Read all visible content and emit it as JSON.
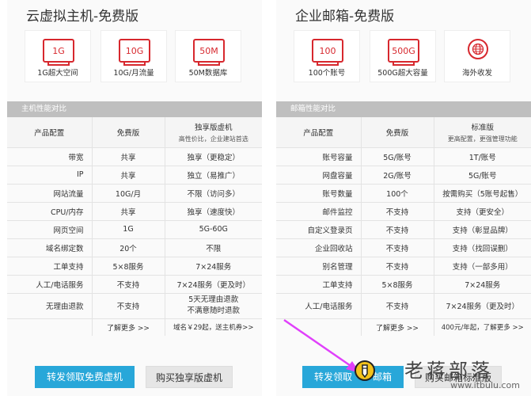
{
  "left": {
    "title": "云虚拟主机-免费版",
    "features": [
      {
        "icon_text": "1G",
        "icon": "storage-icon",
        "caption": "1G超大空间"
      },
      {
        "icon_text": "10G",
        "icon": "traffic-icon",
        "caption": "10G/月流量"
      },
      {
        "icon_text": "50M",
        "icon": "database-icon",
        "caption": "50M数据库"
      }
    ],
    "table_title": "主机性能对比",
    "headers": [
      "产品配置",
      "免费版",
      "独享版虚机"
    ],
    "header_sub": "高性价比，企业建站首选",
    "rows": [
      [
        "带宽",
        "共享",
        "独享（更稳定）"
      ],
      [
        "IP",
        "共享",
        "独立（易推广）"
      ],
      [
        "网站流量",
        "10G/月",
        "不限（访问多）"
      ],
      [
        "CPU/内存",
        "共享",
        "独享（速度快）"
      ],
      [
        "网页空间",
        "1G",
        "5G-60G"
      ],
      [
        "域名绑定数",
        "20个",
        "不限"
      ],
      [
        "工单支持",
        "5×8服务",
        "7×24服务"
      ],
      [
        "人工/电话服务",
        "不支持",
        "7×24服务（更及时）"
      ]
    ],
    "refund": {
      "label": "无理由退款",
      "free": "不支持",
      "line1": "5天无理由退款",
      "line2": "不满意随时退款"
    },
    "footer": {
      "more": "了解更多 >>",
      "promo": "域名￥29起，送主机券>>"
    },
    "btn_primary": "转发领取免费虚机",
    "btn_secondary": "购买独享版虚机"
  },
  "right": {
    "title": "企业邮箱-免费版",
    "features": [
      {
        "icon_text": "100",
        "icon": "accounts-icon",
        "caption": "100个账号"
      },
      {
        "icon_text": "500G",
        "icon": "capacity-icon",
        "caption": "500G超大容量"
      },
      {
        "icon_text": "",
        "icon": "globe-icon",
        "caption": "海外收发"
      }
    ],
    "table_title": "邮箱性能对比",
    "headers": [
      "产品配置",
      "免费版",
      "标准版"
    ],
    "header_sub": "更高配置，更强管理功能",
    "rows": [
      [
        "账号容量",
        "5G/账号",
        "1T/账号"
      ],
      [
        "网盘容量",
        "2G/账号",
        "5G/账号"
      ],
      [
        "账号数量",
        "100个",
        "按需购买（5账号起售）"
      ],
      [
        "邮件监控",
        "不支持",
        "支持（更安全）"
      ],
      [
        "自定义登录页",
        "不支持",
        "支持（彰显品牌）"
      ],
      [
        "企业回收站",
        "不支持",
        "支持（找回误删）"
      ],
      [
        "别名管理",
        "不支持",
        "支持（一部多用）"
      ],
      [
        "工单支持",
        "5×8服务",
        "7×24服务"
      ],
      [
        "人工/电话服务",
        "不支持",
        "7×24服务（更及时）"
      ]
    ],
    "footer": {
      "more": "了解更多 >>",
      "promo": "400元/年起，了解更多 >>"
    },
    "btn_primary": "转发领取",
    "btn_primary_tail": "邮箱",
    "btn_secondary": "购买邮箱标准版"
  },
  "watermark": {
    "brand": "老蒋部落",
    "url": "www.itbulu.com"
  },
  "colors": {
    "accent_red": "#d7282e",
    "button_blue": "#28a7d9",
    "link_blue": "#2a8ed1",
    "arrow_magenta": "#e040fb"
  }
}
